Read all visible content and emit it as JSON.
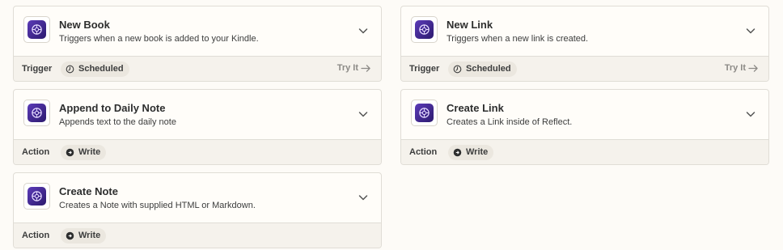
{
  "left": [
    {
      "title": "New Book",
      "description": "Triggers when a new book is added to your Kindle.",
      "kind": "Trigger",
      "badge": "Scheduled",
      "badge_icon": "clock-icon",
      "try_it": "Try It"
    },
    {
      "title": "Append to Daily Note",
      "description": "Appends text to the daily note",
      "kind": "Action",
      "badge": "Write",
      "badge_icon": "write-icon"
    },
    {
      "title": "Create Note",
      "description": "Creates a Note with supplied HTML or Markdown.",
      "kind": "Action",
      "badge": "Write",
      "badge_icon": "write-icon"
    }
  ],
  "right": [
    {
      "title": "New Link",
      "description": "Triggers when a new link is created.",
      "kind": "Trigger",
      "badge": "Scheduled",
      "badge_icon": "clock-icon",
      "try_it": "Try It"
    },
    {
      "title": "Create Link",
      "description": "Creates a Link inside of Reflect.",
      "kind": "Action",
      "badge": "Write",
      "badge_icon": "write-icon"
    }
  ],
  "colors": {
    "background": "#fdfbf7",
    "app_icon": "#4a2fa0",
    "footer": "#f5f2ec"
  }
}
